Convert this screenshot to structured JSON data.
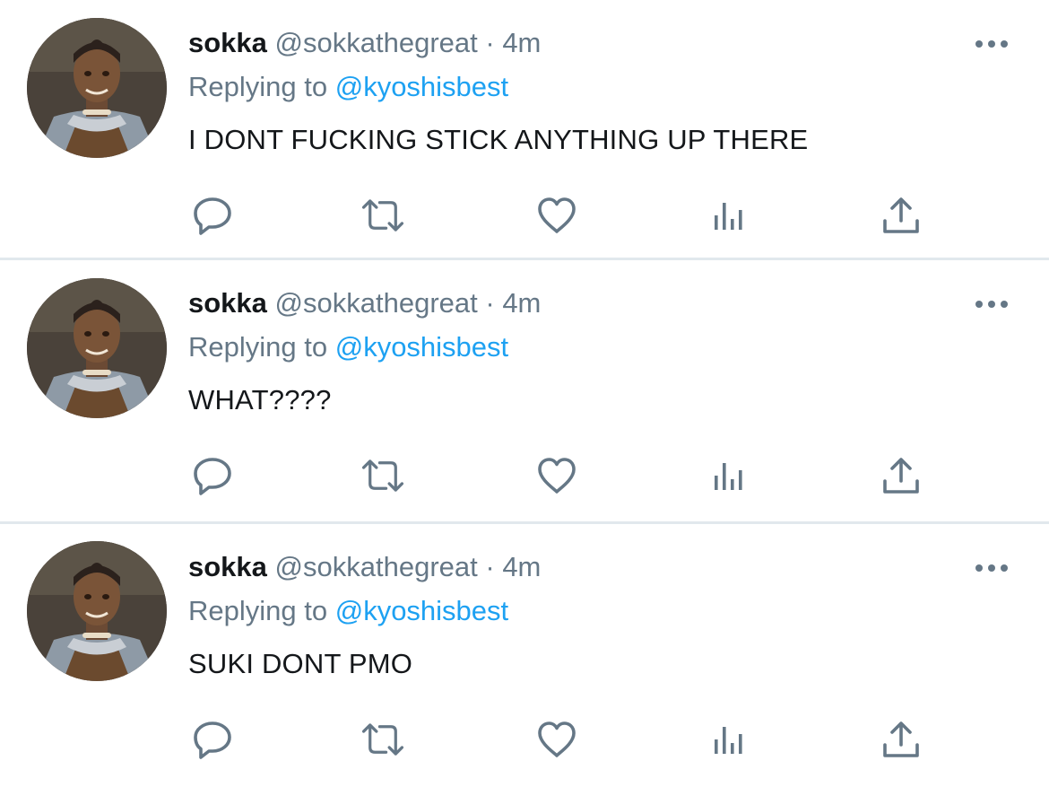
{
  "tweets": [
    {
      "name": "sokka",
      "handle": "@sokkathegreat",
      "separator": "·",
      "time": "4m",
      "replying_prefix": "Replying to",
      "replying_to": "@kyoshisbest",
      "text": "I DONT FUCKING STICK ANYTHING UP THERE"
    },
    {
      "name": "sokka",
      "handle": "@sokkathegreat",
      "separator": "·",
      "time": "4m",
      "replying_prefix": "Replying to",
      "replying_to": "@kyoshisbest",
      "text": "WHAT????"
    },
    {
      "name": "sokka",
      "handle": "@sokkathegreat",
      "separator": "·",
      "time": "4m",
      "replying_prefix": "Replying to",
      "replying_to": "@kyoshisbest",
      "text": "SUKI DONT PMO"
    }
  ],
  "icons": {
    "reply": "reply-icon",
    "retweet": "retweet-icon",
    "like": "heart-icon",
    "analytics": "analytics-icon",
    "share": "share-icon",
    "more": "more-icon"
  },
  "colors": {
    "text": "#14171a",
    "secondary": "#657786",
    "link": "#1da1f2",
    "divider": "#e1e8ed"
  }
}
